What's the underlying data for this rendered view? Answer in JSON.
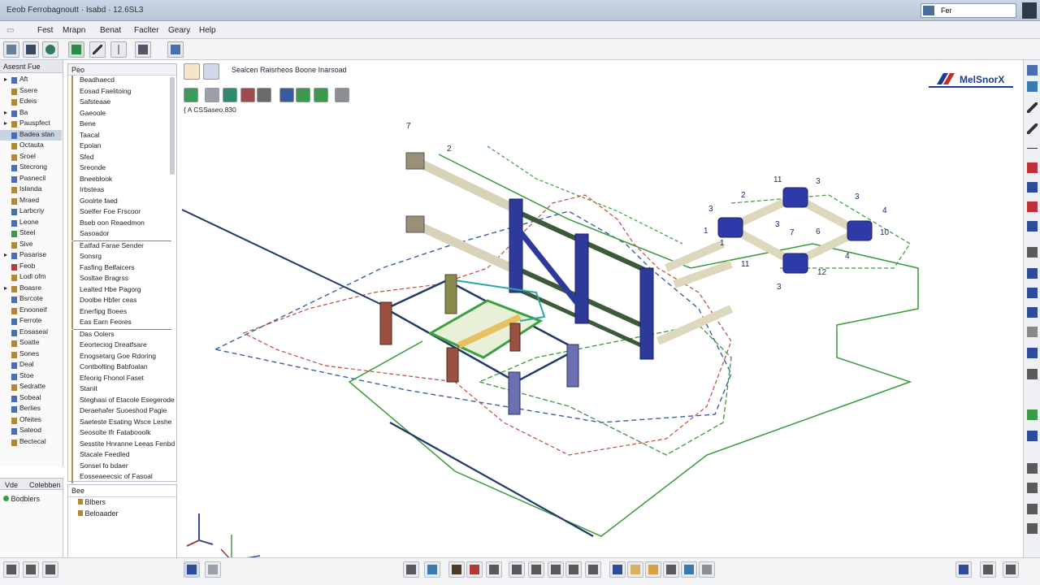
{
  "app": {
    "window_title": "Eeob Ferrobagnoutt · Isabd · 12.6SL3",
    "search_value": "Fer"
  },
  "menu": [
    "Fest",
    "Mrapn",
    "Benat",
    "Faclter",
    "Geary",
    "Help"
  ],
  "left_panel": {
    "header": "Asesnt Fue",
    "items": [
      {
        "label": "Aft",
        "color": "#4a6fb0",
        "toggle": "▸"
      },
      {
        "label": "Ssere",
        "color": "#b0883a",
        "toggle": ""
      },
      {
        "label": "Edeis",
        "color": "#b0883a",
        "toggle": ""
      },
      {
        "label": "Ba",
        "color": "#4a6fb0",
        "toggle": "▸"
      },
      {
        "label": "Pauspfect",
        "color": "#b0883a",
        "toggle": "▸"
      },
      {
        "label": "Badea stan",
        "color": "#4a6fb0",
        "toggle": "",
        "selected": true
      },
      {
        "label": "Octauta",
        "color": "#b0883a",
        "toggle": ""
      },
      {
        "label": "Sroel",
        "color": "#b0883a",
        "toggle": ""
      },
      {
        "label": "Stecrong",
        "color": "#4a6fb0",
        "toggle": ""
      },
      {
        "label": "Pasnecil",
        "color": "#4a6fb0",
        "toggle": ""
      },
      {
        "label": "Islanda",
        "color": "#b0883a",
        "toggle": ""
      },
      {
        "label": "Mraed",
        "color": "#b0883a",
        "toggle": ""
      },
      {
        "label": "Larbcriy",
        "color": "#4a6fb0",
        "toggle": ""
      },
      {
        "label": "Leone",
        "color": "#4a6fb0",
        "toggle": ""
      },
      {
        "label": "Steel",
        "color": "#3a9a4a",
        "toggle": ""
      },
      {
        "label": "Sive",
        "color": "#b0883a",
        "toggle": ""
      },
      {
        "label": "Pasarise",
        "color": "#4a6fb0",
        "toggle": "▸"
      },
      {
        "label": "Feob",
        "color": "#b04040",
        "toggle": ""
      },
      {
        "label": "Lodl ofm",
        "color": "#b0883a",
        "toggle": ""
      },
      {
        "label": "Boasre",
        "color": "#b0883a",
        "toggle": "▸"
      },
      {
        "label": "Bsrcote",
        "color": "#4a6fb0",
        "toggle": ""
      },
      {
        "label": "Enooneif",
        "color": "#b0883a",
        "toggle": ""
      },
      {
        "label": "Ferrote",
        "color": "#4a6fb0",
        "toggle": ""
      },
      {
        "label": "Eosaseal",
        "color": "#4a6fb0",
        "toggle": ""
      },
      {
        "label": "Soatte",
        "color": "#b0883a",
        "toggle": ""
      },
      {
        "label": "Sones",
        "color": "#b0883a",
        "toggle": ""
      },
      {
        "label": "Deal",
        "color": "#4a6fb0",
        "toggle": ""
      },
      {
        "label": "Stoe",
        "color": "#4a6fb0",
        "toggle": ""
      },
      {
        "label": "Sedratte",
        "color": "#b0883a",
        "toggle": ""
      },
      {
        "label": "Sobeal",
        "color": "#4a6fb0",
        "toggle": ""
      },
      {
        "label": "Berlies",
        "color": "#4a6fb0",
        "toggle": ""
      },
      {
        "label": "Ofeites",
        "color": "#b0883a",
        "toggle": ""
      },
      {
        "label": "Sateod",
        "color": "#4a6fb0",
        "toggle": ""
      },
      {
        "label": "Bectecal",
        "color": "#b0883a",
        "toggle": ""
      }
    ]
  },
  "mid_panel": {
    "header": "Peo",
    "groups": [
      [
        "Beadhaecd",
        "Eosad Faelitoing",
        "Safsteaae",
        "Gaeoole",
        "Bene",
        "Taacal",
        "Epolan",
        "Sfed",
        "Sreonde",
        "Bneeblook",
        "Irbsteas",
        "Goolrte faed",
        "Soelfer Foe Frscoor",
        "Bseb oon Reaedmon",
        "Sasoador"
      ],
      [
        "Eatfad Farae Sender",
        "Sonsrg",
        "Fasfing Belfaicers",
        "Sosltae Bragrss",
        "Lealted Hbe Pagorg",
        "Doolbe Hbfer ceas",
        "Enerfipg Boees",
        "Eas Earn Feores"
      ],
      [
        "Das Oolers",
        "Eeorteciog Dreatfsare",
        "Enogsetarg Goe Rdoring",
        "Contbolting Babfoalan",
        "Efeorig Fhonol Faset",
        "Stanit",
        "Steghasi of Etacole Esegerode",
        "Deraehafer Suoeshod Pagie",
        "Saeteste Esating Wsce Leshe",
        "Seosolte Ifr Fatabooolk",
        "Sesstite Hnranne Leeas Fenbd",
        "Stacale Feedled",
        "Sonsel fo bdaer",
        "Eosseaeecsic of Fasoal"
      ]
    ]
  },
  "bottom_left": {
    "tab1": "Vde",
    "tab2": "Colebben",
    "item": "Bodblers"
  },
  "bottom_mid": {
    "header": "Bee",
    "items": [
      "Blbers",
      "Beloaader"
    ]
  },
  "viewport": {
    "title": "Sealcen Raisrheos Boone Inarsoad",
    "subtitle": "{ A CSSaseo.830",
    "logo": "MelSnorX",
    "callouts": [
      "7",
      "2",
      "11",
      "3",
      "3",
      "2",
      "3",
      "1",
      "4",
      "10",
      "3",
      "7",
      "6",
      "12",
      "4",
      "1",
      "11",
      "3"
    ]
  }
}
